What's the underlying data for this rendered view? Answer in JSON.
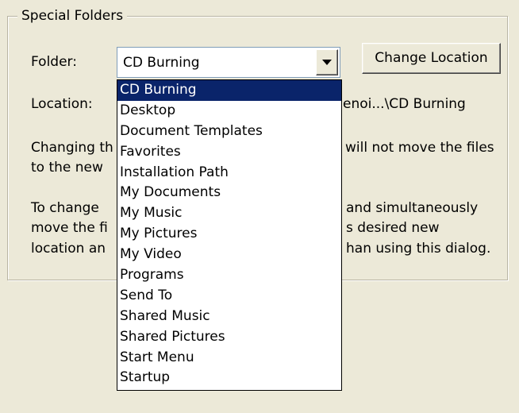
{
  "group": {
    "title": "Special Folders"
  },
  "folder": {
    "label": "Folder:",
    "selected": "CD Burning",
    "options": [
      "CD Burning",
      "Desktop",
      "Document Templates",
      "Favorites",
      "Installation Path",
      "My Documents",
      "My Music",
      "My Pictures",
      "My Video",
      "Programs",
      "Send To",
      "Shared Music",
      "Shared Pictures",
      "Start Menu",
      "Startup"
    ]
  },
  "change_location_label": "Change Location",
  "location": {
    "label": "Location:",
    "value_visible": "enoi...\\CD Burning"
  },
  "info": {
    "para1_left": [
      "Changing th",
      "to the new"
    ],
    "para1_right": [
      "will not move the files"
    ],
    "para2_left": [
      "To change",
      "move the fi",
      "location an"
    ],
    "para2_right": [
      "and simultaneously",
      "s desired new",
      "han using this dialog."
    ]
  },
  "colors": {
    "dialog_bg": "#ece9d8",
    "selection_bg": "#0a246a",
    "combo_border": "#7f9db9"
  },
  "icons": {
    "dropdown_arrow": "chevron-down-icon"
  }
}
